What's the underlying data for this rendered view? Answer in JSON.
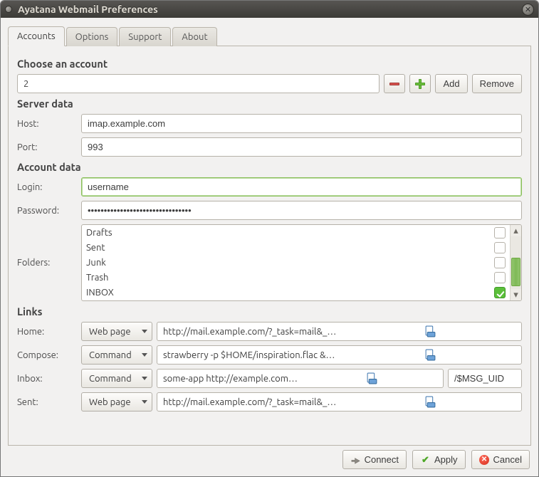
{
  "window": {
    "title": "Ayatana Webmail Preferences"
  },
  "tabs": [
    {
      "label": "Accounts"
    },
    {
      "label": "Options"
    },
    {
      "label": "Support"
    },
    {
      "label": "About"
    }
  ],
  "account_select": {
    "heading": "Choose an account",
    "value": "2",
    "add_label": "Add",
    "remove_label": "Remove"
  },
  "server": {
    "heading": "Server data",
    "host_label": "Host:",
    "host_value": "imap.example.com",
    "port_label": "Port:",
    "port_value": "993"
  },
  "account": {
    "heading": "Account data",
    "login_label": "Login:",
    "login_value": "username",
    "password_label": "Password:",
    "password_value": "••••••••••••••••••••••••••••••••",
    "folders_label": "Folders:",
    "folders": [
      {
        "name": "Drafts",
        "checked": false
      },
      {
        "name": "Sent",
        "checked": false
      },
      {
        "name": "Junk",
        "checked": false
      },
      {
        "name": "Trash",
        "checked": false
      },
      {
        "name": "INBOX",
        "checked": true
      }
    ]
  },
  "links": {
    "heading": "Links",
    "home_label": "Home:",
    "home_type": "Web page",
    "home_value": "http://mail.example.com/?_task=mail&_mbox=INBOX",
    "compose_label": "Compose:",
    "compose_type": "Command",
    "compose_value": "strawberry -p $HOME/inspiration.flac && libreoffice --writer&",
    "inbox_label": "Inbox:",
    "inbox_type": "Command",
    "inbox_value": "some-app http://example.com/read",
    "inbox_suffix": "/$MSG_UID",
    "sent_label": "Sent:",
    "sent_type": "Web page",
    "sent_value": "http://mail.example.com/?_task=mail&_mbox=Sent"
  },
  "footer": {
    "connect": "Connect",
    "apply": "Apply",
    "cancel": "Cancel"
  }
}
